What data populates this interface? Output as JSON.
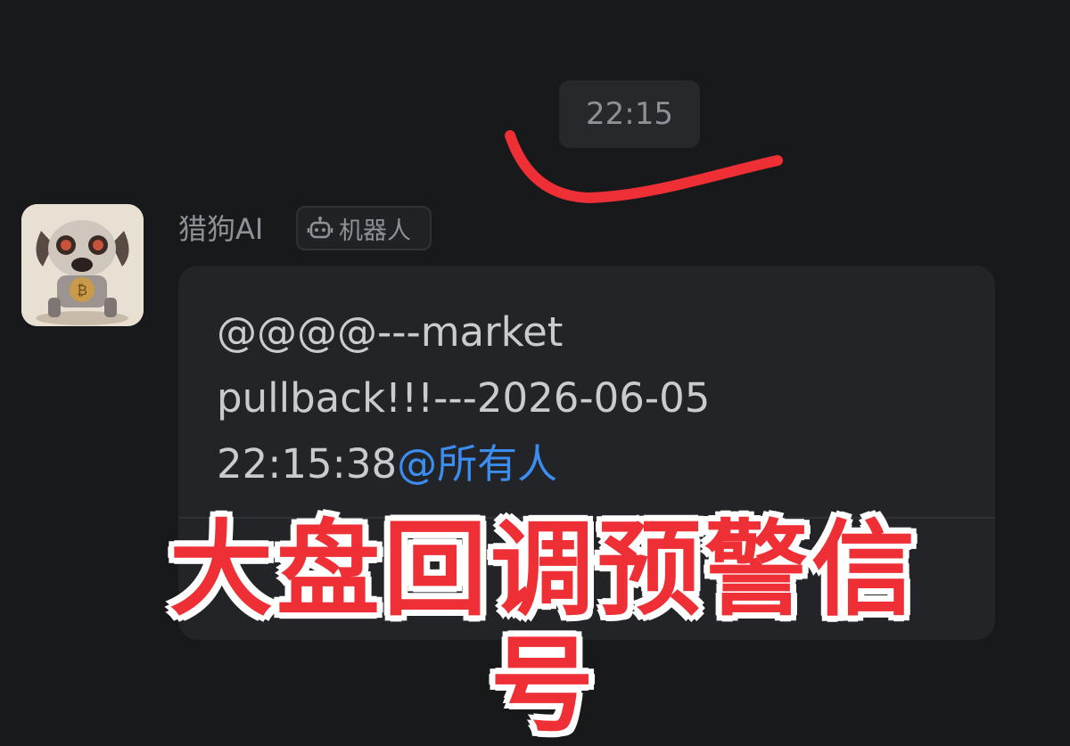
{
  "timestamp": "22:15",
  "message": {
    "sender": {
      "name": "猎狗AI",
      "badge_label": "机器人",
      "badge_icon": "robot-icon",
      "avatar": "robot-dog-bitcoin-avatar"
    },
    "text_line1": "@@@@---market",
    "text_line2": "pullback!!!---2026-06-05",
    "text_line3": "22:15:38",
    "mention": "@所有人"
  },
  "overlay_caption": "大盘回调预警信号",
  "colors": {
    "background": "#18191b",
    "bubble": "#222428",
    "mention": "#3c8df0",
    "annotation_red": "#ee2f35"
  }
}
